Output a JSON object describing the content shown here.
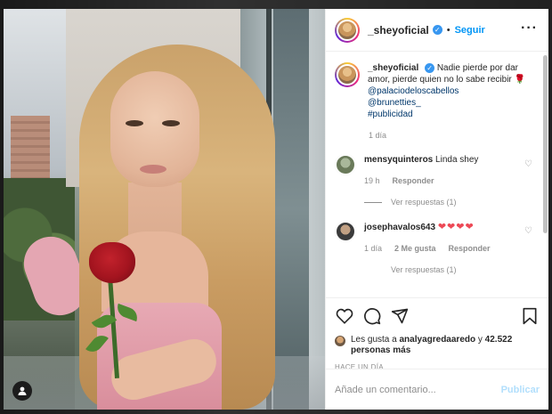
{
  "header": {
    "username": "_sheyoficial",
    "follow_label": "Seguir",
    "separator": "•",
    "more_icon": "more-horizontal-icon"
  },
  "caption": {
    "username": "_sheyoficial",
    "text": "Nadie pierde por dar amor, pierde quien no lo sabe recibir",
    "emoji": "🌹",
    "mentions": [
      "@palaciodeloscabellos",
      "@brunetties_"
    ],
    "hashtag": "#publicidad",
    "time": "1 día"
  },
  "comments": [
    {
      "username": "mensyquinteros",
      "text": "Linda shey",
      "time": "19 h",
      "likes": "",
      "reply_label": "Responder",
      "view_replies": "Ver respuestas (1)"
    },
    {
      "username": "josephavalos643",
      "text": "❤❤❤❤",
      "time": "1 día",
      "likes": "2 Me gusta",
      "reply_label": "Responder",
      "view_replies": "Ver respuestas (1)"
    }
  ],
  "likes": {
    "prefix": "Les gusta a",
    "user": "analyagredaaredo",
    "connector": "y",
    "count": "42.522 personas más"
  },
  "date": "HACE UN DÍA",
  "add_comment": {
    "placeholder": "Añade un comentario...",
    "publish_label": "Publicar"
  },
  "colors": {
    "accent": "#0095f6",
    "heart": "#ed4956",
    "verified": "#3897f0",
    "muted": "#8e8e8e",
    "publish_disabled": "#b2dffc"
  }
}
